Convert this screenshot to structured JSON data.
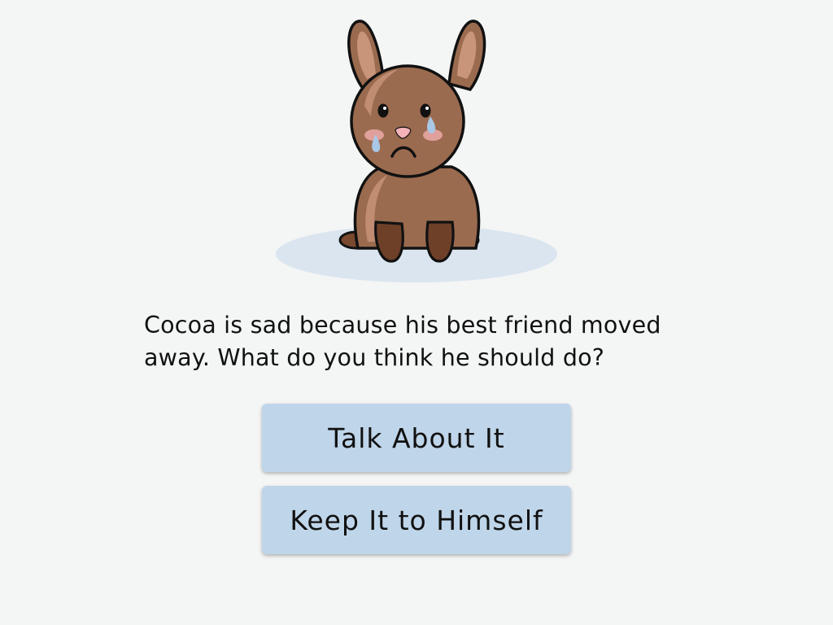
{
  "character": {
    "icon": "sad-bunny-icon",
    "colors": {
      "fur": "#9b6b4f",
      "fur_dark": "#6e4028",
      "fur_light": "#c9957a",
      "outline": "#111111",
      "tear": "#a9c8e6",
      "blush": "#e8a6a3",
      "nose": "#f3b3b8",
      "shadow": "#dae5ef"
    }
  },
  "story": {
    "prompt": "Cocoa is sad because his best friend moved away. What do you think he should do?"
  },
  "choices": [
    {
      "label": "Talk About It"
    },
    {
      "label": "Keep It to Himself"
    }
  ],
  "theme": {
    "background": "#f4f5f5",
    "button_bg": "#bfd5e9"
  }
}
